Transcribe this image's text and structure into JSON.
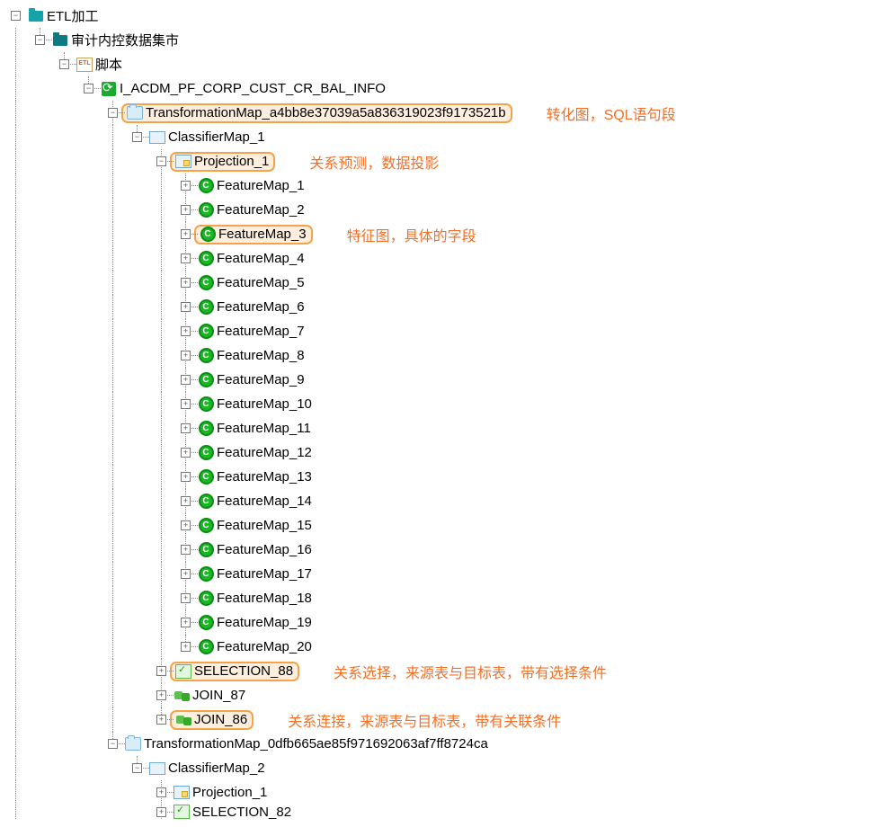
{
  "tree": {
    "root_label": "ETL加工",
    "l1_label": "审计内控数据集市",
    "l2_label": "脚本",
    "l2_icon_text": "ETL",
    "l3_label": "I_ACDM_PF_CORP_CUST_CR_BAL_INFO",
    "tmap1": {
      "label": "TransformationMap_a4bb8e37039a5a836319023f9173521b",
      "classifier_label": "ClassifierMap_1",
      "projection_label": "Projection_1",
      "features": [
        "FeatureMap_1",
        "FeatureMap_2",
        "FeatureMap_3",
        "FeatureMap_4",
        "FeatureMap_5",
        "FeatureMap_6",
        "FeatureMap_7",
        "FeatureMap_8",
        "FeatureMap_9",
        "FeatureMap_10",
        "FeatureMap_11",
        "FeatureMap_12",
        "FeatureMap_13",
        "FeatureMap_14",
        "FeatureMap_15",
        "FeatureMap_16",
        "FeatureMap_17",
        "FeatureMap_18",
        "FeatureMap_19",
        "FeatureMap_20"
      ],
      "feature_icon_text": "C",
      "selection_label": "SELECTION_88",
      "join1_label": "JOIN_87",
      "join2_label": "JOIN_86"
    },
    "tmap2": {
      "label": "TransformationMap_0dfb665ae85f971692063af7ff8724ca",
      "classifier_label": "ClassifierMap_2",
      "projection_label": "Projection_1",
      "selection_label": "SELECTION_82"
    }
  },
  "annot": {
    "tmap": "转化图，SQL语句段",
    "projection": "关系预测，数据投影",
    "feature": "特征图，具体的字段",
    "selection": "关系选择，来源表与目标表，带有选择条件",
    "join": "关系连接，来源表与目标表，带有关联条件"
  },
  "toggle": {
    "plus": "+",
    "minus": "−"
  }
}
